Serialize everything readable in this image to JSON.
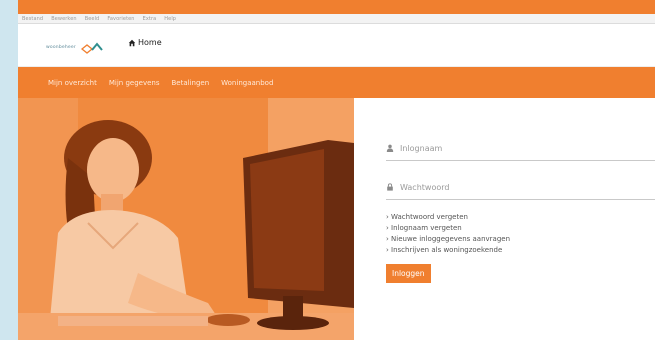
{
  "menubar": {
    "items": [
      "Bestand",
      "Bewerken",
      "Beeld",
      "Favorieten",
      "Extra",
      "Help"
    ]
  },
  "header": {
    "logo_text": "woonbeheer",
    "home_label": "Home"
  },
  "nav": {
    "items": [
      "Mijn overzicht",
      "Mijn gegevens",
      "Betalingen",
      "Woningaanbod"
    ]
  },
  "login": {
    "username_placeholder": "Inlognaam",
    "password_placeholder": "Wachtwoord",
    "links": [
      "› Wachtwoord vergeten",
      "› Inlognaam vergeten",
      "› Nieuwe inloggegevens aanvragen",
      "› Inschrijven als woningzoekende"
    ],
    "button_label": "Inloggen"
  },
  "colors": {
    "brand_orange": "#f07f2f",
    "page_bg": "#cfe6ef"
  },
  "icons": [
    "home-icon",
    "user-icon",
    "lock-icon"
  ]
}
